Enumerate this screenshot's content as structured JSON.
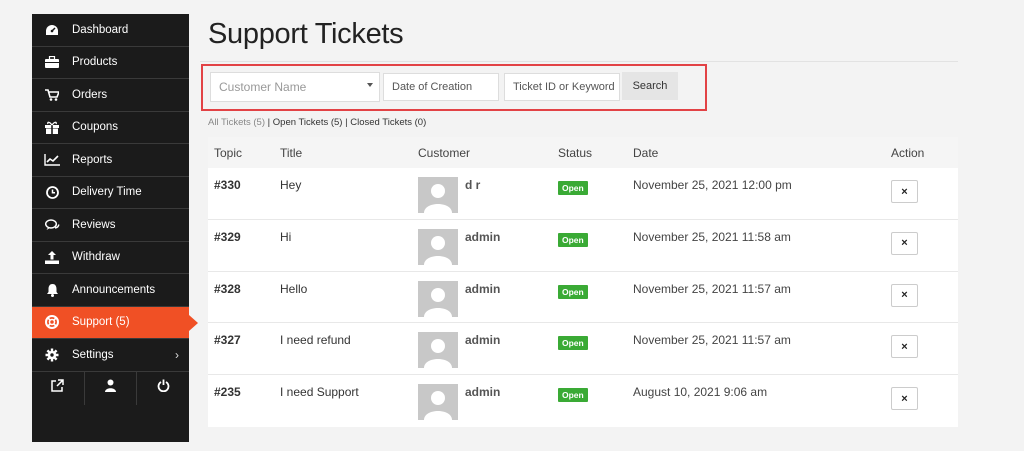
{
  "sidebar": {
    "items": [
      {
        "label": "Dashboard",
        "icon": "dashboard-icon"
      },
      {
        "label": "Products",
        "icon": "briefcase-icon"
      },
      {
        "label": "Orders",
        "icon": "cart-icon"
      },
      {
        "label": "Coupons",
        "icon": "gift-icon"
      },
      {
        "label": "Reports",
        "icon": "line-chart-icon"
      },
      {
        "label": "Delivery Time",
        "icon": "clock-icon"
      },
      {
        "label": "Reviews",
        "icon": "comments-icon"
      },
      {
        "label": "Withdraw",
        "icon": "upload-icon"
      },
      {
        "label": "Announcements",
        "icon": "bell-icon"
      },
      {
        "label": "Support (5)",
        "icon": "lifebuoy-icon",
        "active": true
      },
      {
        "label": "Settings",
        "icon": "gear-icon"
      }
    ],
    "bottom": [
      "external-link-icon",
      "user-icon",
      "power-icon"
    ],
    "active_color": "#f05025"
  },
  "page": {
    "title": "Support Tickets"
  },
  "filters": {
    "customer_placeholder": "Customer Name",
    "date_placeholder": "Date of Creation",
    "keyword_placeholder": "Ticket ID or Keyword",
    "search_label": "Search"
  },
  "status_links": {
    "all": "All Tickets (5)",
    "sep1": " | ",
    "open": "Open Tickets (5)",
    "sep2": " | ",
    "closed": "Closed Tickets (0)"
  },
  "table": {
    "headers": {
      "topic": "Topic",
      "title": "Title",
      "customer": "Customer",
      "status": "Status",
      "date": "Date",
      "action": "Action"
    },
    "rows": [
      {
        "topic": "#330",
        "title": "Hey",
        "customer": "d r",
        "status": "Open",
        "date": "November 25, 2021 12:00 pm",
        "action": "×"
      },
      {
        "topic": "#329",
        "title": "Hi",
        "customer": "admin",
        "status": "Open",
        "date": "November 25, 2021 11:58 am",
        "action": "×"
      },
      {
        "topic": "#328",
        "title": "Hello",
        "customer": "admin",
        "status": "Open",
        "date": "November 25, 2021 11:57 am",
        "action": "×"
      },
      {
        "topic": "#327",
        "title": "I need refund",
        "customer": "admin",
        "status": "Open",
        "date": "November 25, 2021 11:57 am",
        "action": "×"
      },
      {
        "topic": "#235",
        "title": "I need Support",
        "customer": "admin",
        "status": "Open",
        "date": "August 10, 2021 9:06 am",
        "action": "×"
      }
    ],
    "status_color": "#3aaa35"
  }
}
